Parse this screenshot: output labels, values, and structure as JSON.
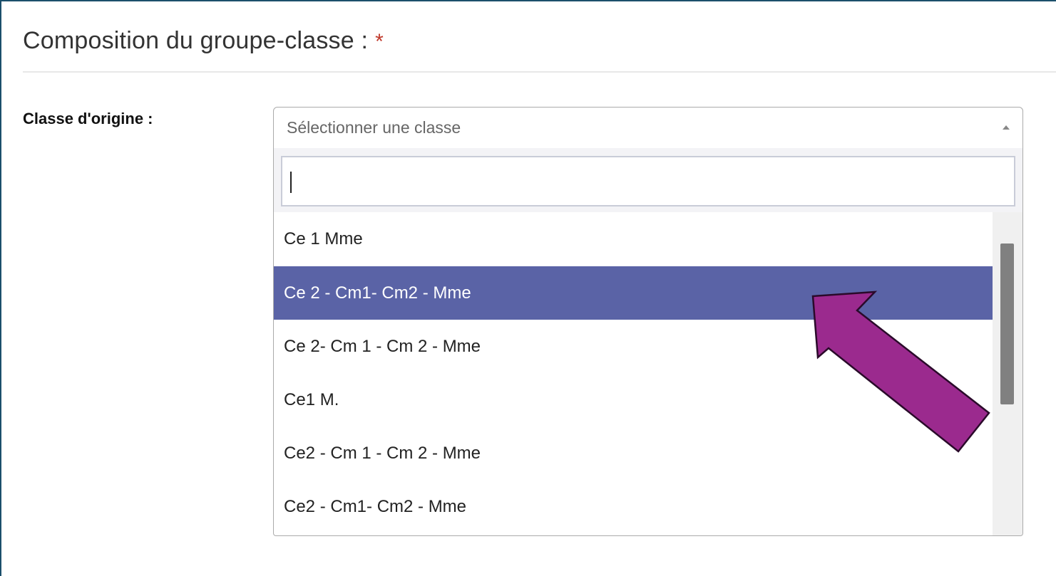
{
  "section": {
    "title": "Composition du groupe-classe :",
    "required_mark": "*"
  },
  "field": {
    "label": "Classe d'origine :",
    "placeholder": "Sélectionner une classe"
  },
  "dropdown": {
    "search_value": "",
    "options": [
      "Ce 1 Mme",
      "Ce 2 - Cm1- Cm2 - Mme",
      "Ce 2- Cm 1 - Cm 2 - Mme",
      "Ce1 M.",
      "Ce2 - Cm 1 - Cm 2 - Mme",
      "Ce2 - Cm1- Cm2 - Mme"
    ],
    "highlighted_option": "Ce 2 - Cm1- Cm2 - Mme"
  },
  "colors": {
    "highlight": "#5a63a6",
    "annotation_arrow": "#9b2a8e",
    "required": "#c0392b"
  },
  "icons": {
    "select_toggle": "caret-up-icon",
    "annotation": "arrow-pointer-annotation"
  }
}
